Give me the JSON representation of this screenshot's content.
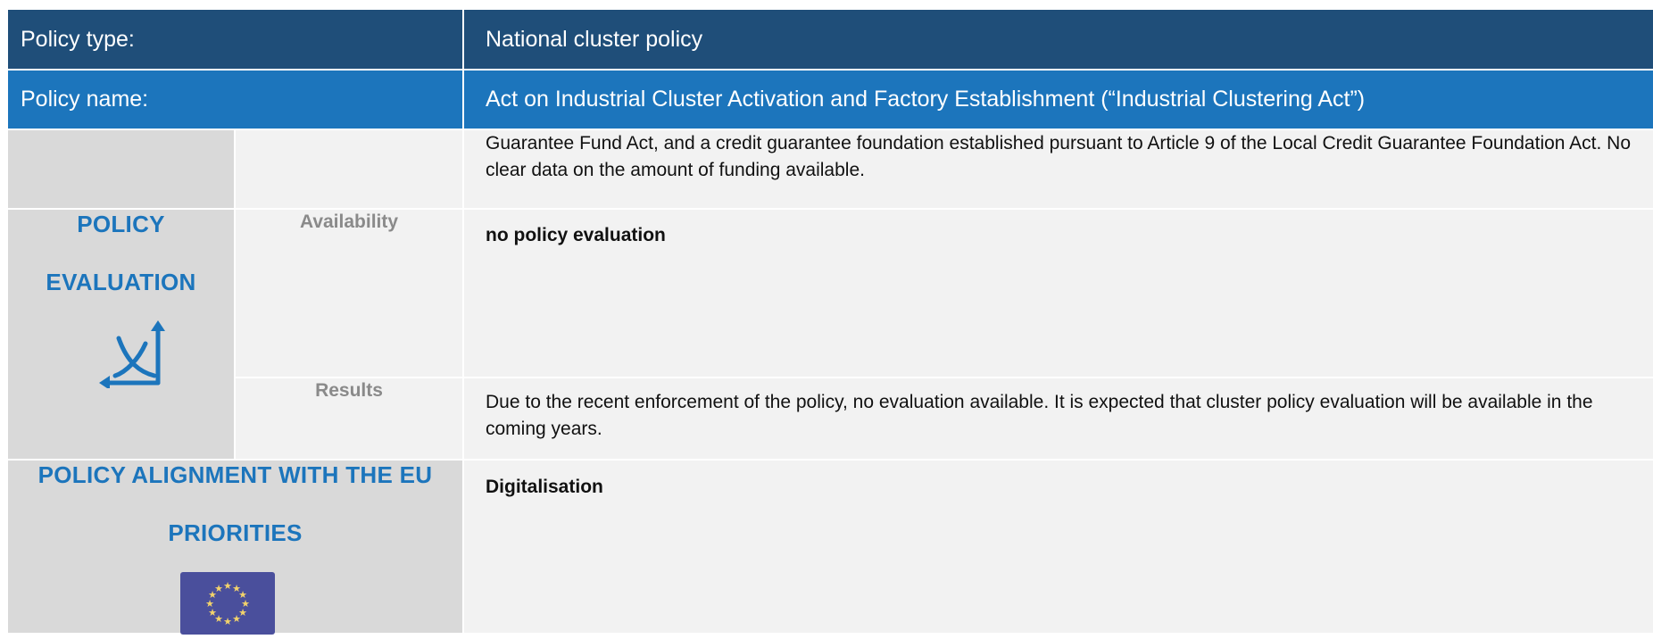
{
  "header": {
    "policy_type_label": "Policy type:",
    "policy_type_value": "National cluster policy",
    "policy_name_label": "Policy name:",
    "policy_name_value": "Act on Industrial Cluster Activation and Factory Establishment (“Industrial Clustering Act”)"
  },
  "funding_continuation": {
    "text": "Guarantee Fund Act, and a credit guarantee foundation established pursuant to Article 9 of the Local Credit Guarantee Foundation Act. No clear data on the amount of funding available."
  },
  "policy_evaluation": {
    "title_line1": "POLICY",
    "title_line2": "EVALUATION",
    "icon": "evaluation-chart-icon",
    "availability_label": "Availability",
    "availability_value": "no policy evaluation",
    "results_label": "Results",
    "results_value": "Due to the recent enforcement of the policy, no evaluation available. It is expected that cluster policy evaluation will be available in the coming years."
  },
  "eu_alignment": {
    "title_line1": "POLICY ALIGNMENT WITH THE EU",
    "title_line2": "PRIORITIES",
    "icon": "eu-flag-icon",
    "priority": "Digitalisation"
  },
  "colors": {
    "dark_blue": "#1f4e79",
    "mid_blue": "#1c75bc",
    "label_grey": "#d9d9d9",
    "cell_light": "#f2f2f2",
    "eu_blue": "#4a4f9c",
    "eu_star": "#f3d36b"
  }
}
